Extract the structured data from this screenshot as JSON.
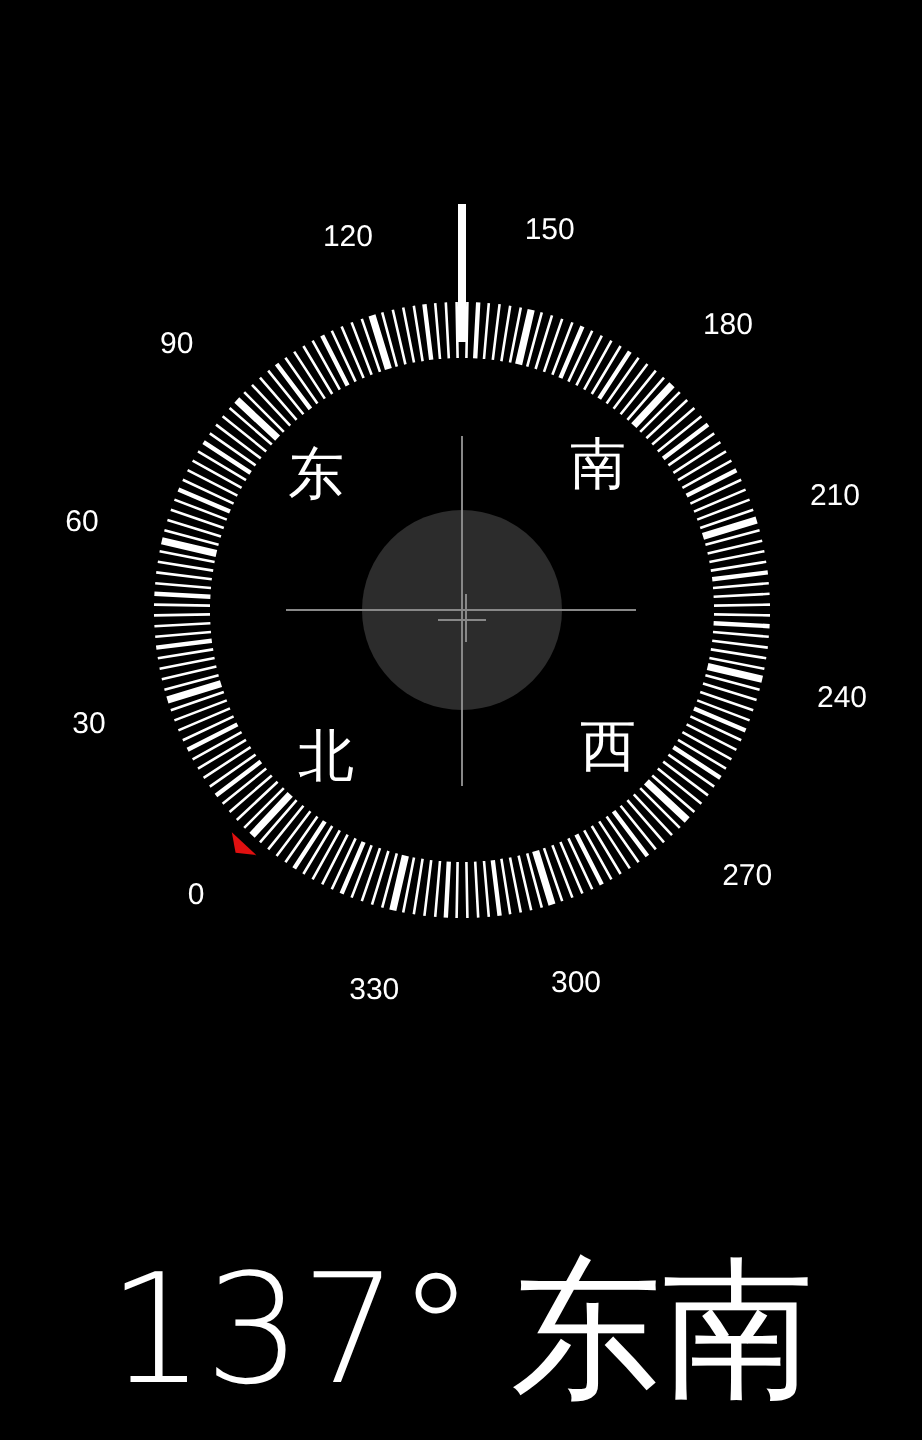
{
  "dial_labels": [
    "0",
    "30",
    "60",
    "90",
    "120",
    "150",
    "180",
    "210",
    "240",
    "270",
    "300",
    "330"
  ],
  "cardinal_labels": [
    {
      "kind": "east",
      "text": "东"
    },
    {
      "kind": "south",
      "text": "南"
    },
    {
      "kind": "north",
      "text": "北"
    },
    {
      "kind": "west",
      "text": "西"
    }
  ],
  "readout": {
    "heading": "137°",
    "direction": "东南"
  }
}
